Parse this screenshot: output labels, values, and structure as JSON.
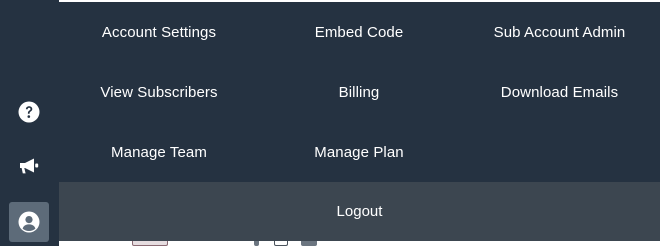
{
  "menu": {
    "items": [
      {
        "label": "Account Settings"
      },
      {
        "label": "Embed Code"
      },
      {
        "label": "Sub Account Admin"
      },
      {
        "label": "View Subscribers"
      },
      {
        "label": "Billing"
      },
      {
        "label": "Download Emails"
      },
      {
        "label": "Manage Team"
      },
      {
        "label": "Manage Plan"
      }
    ],
    "logout_label": "Logout"
  },
  "rail": {
    "icons": [
      "question-circle-icon",
      "megaphone-icon",
      "user-circle-icon"
    ]
  },
  "colors": {
    "panel_bg": "#253241",
    "logout_bg": "#3c4650",
    "active_icon_bg": "#5d6b79",
    "text": "#ffffff"
  }
}
